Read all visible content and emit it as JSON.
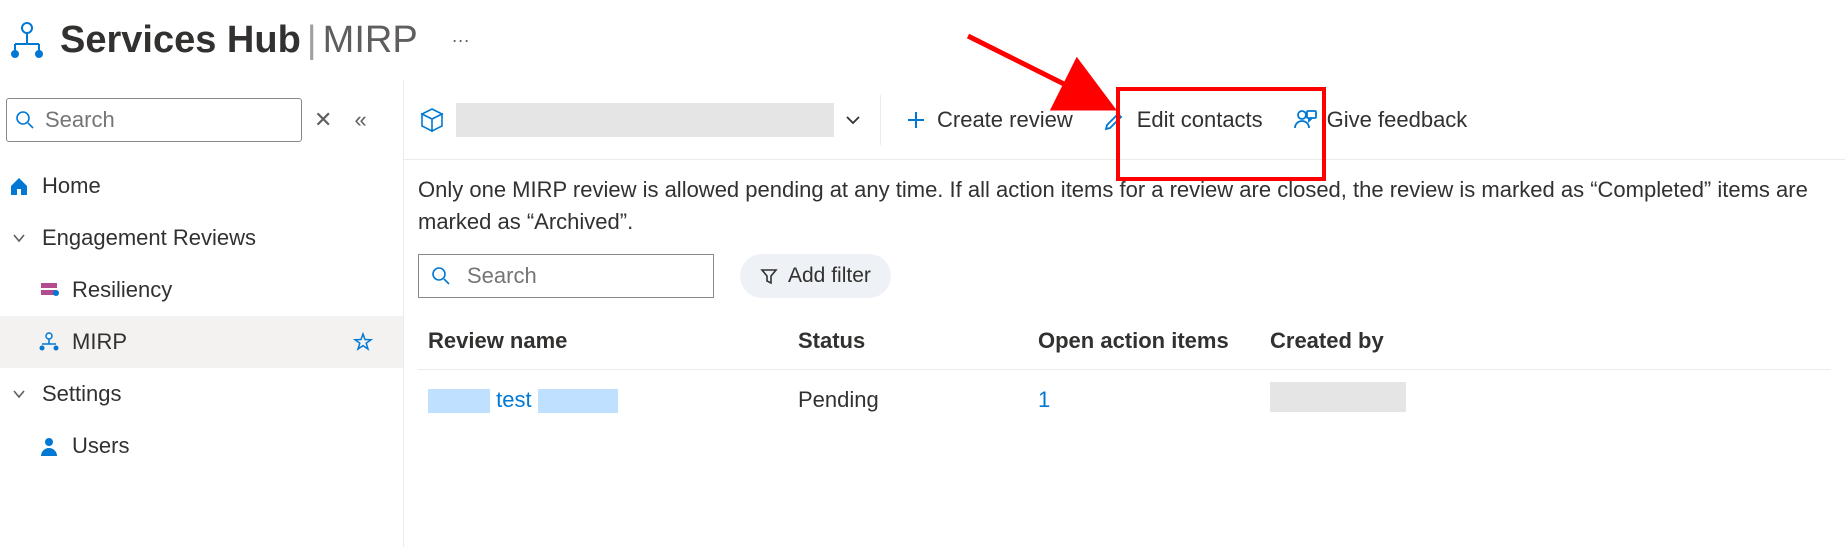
{
  "header": {
    "title_bold": "Services Hub",
    "title_light": "MIRP",
    "ellipsis": "···"
  },
  "sidebar": {
    "search_placeholder": "Search",
    "items": {
      "home": "Home",
      "engagement": "Engagement Reviews",
      "resiliency": "Resiliency",
      "mirp": "MIRP",
      "settings": "Settings",
      "users": "Users"
    }
  },
  "toolbar": {
    "create_review": "Create review",
    "edit_contacts": "Edit contacts",
    "give_feedback": "Give feedback"
  },
  "description": "Only one MIRP review is allowed pending at any time. If all action items for a review are closed, the review is marked as “Completed” items are marked as “Archived”.",
  "filter": {
    "search_placeholder": "Search",
    "add_filter": "Add filter"
  },
  "table": {
    "headers": {
      "name": "Review name",
      "status": "Status",
      "open": "Open action items",
      "created": "Created by"
    },
    "rows": [
      {
        "name_middle": "test",
        "status": "Pending",
        "open": "1"
      }
    ]
  }
}
